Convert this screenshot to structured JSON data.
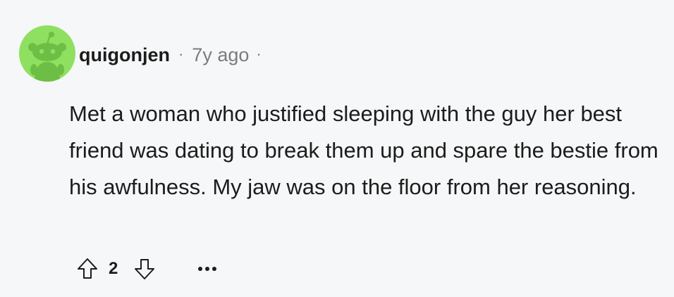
{
  "comment": {
    "author": "quigonjen",
    "separator": "·",
    "timestamp": "7y ago",
    "body": "Met a woman who justified sleeping with the guy her best friend was dating to break them up and spare the bestie from his awfulness. My jaw was on the floor from her reasoning.",
    "score": "2"
  },
  "icons": {
    "avatar": "snoo-avatar-icon",
    "upvote": "arrow-up-outline-icon",
    "downvote": "arrow-down-outline-icon",
    "more": "more-options-ellipsis-icon"
  },
  "colors": {
    "background": "#f6f7f8",
    "avatar_bg": "#8fe060",
    "avatar_figure": "#6cbf44",
    "text": "#1c1c1c",
    "muted": "#787c7e"
  }
}
